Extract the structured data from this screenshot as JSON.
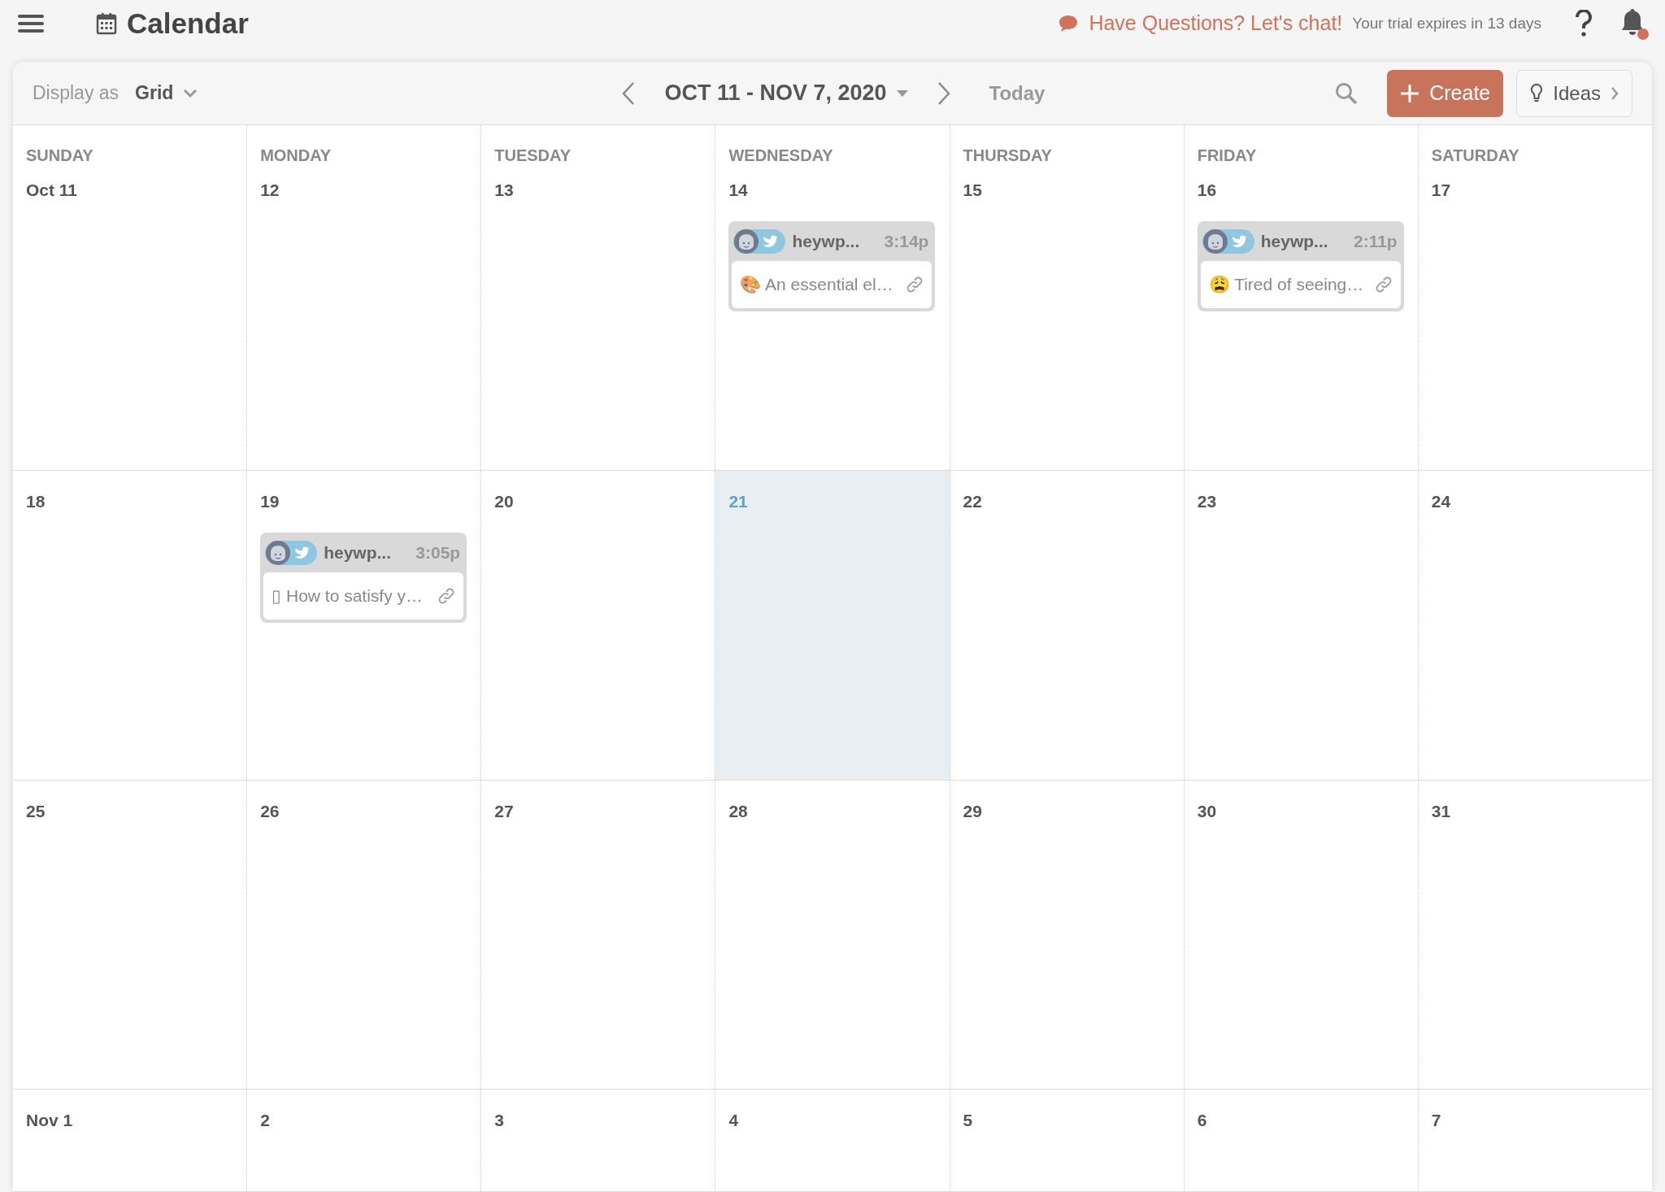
{
  "header": {
    "title": "Calendar",
    "chat_link": "Have Questions? Let's chat!",
    "trial_note": "Your trial expires in 13 days",
    "notification_dot": true
  },
  "toolbar": {
    "display_label": "Display as",
    "display_value": "Grid",
    "range": "OCT 11 - NOV 7, 2020",
    "today": "Today",
    "create": "Create",
    "ideas": "Ideas"
  },
  "weekdays": [
    "SUNDAY",
    "MONDAY",
    "TUESDAY",
    "WEDNESDAY",
    "THURSDAY",
    "FRIDAY",
    "SATURDAY"
  ],
  "weeks": [
    {
      "cells": [
        {
          "date": "Oct 11",
          "today": false
        },
        {
          "date": "12",
          "today": false
        },
        {
          "date": "13",
          "today": false
        },
        {
          "date": "14",
          "today": false,
          "events": [
            {
              "account": "heywp...",
              "time": "3:14p",
              "text": "🎨 An essential el…"
            }
          ]
        },
        {
          "date": "15",
          "today": false
        },
        {
          "date": "16",
          "today": false,
          "events": [
            {
              "account": "heywp...",
              "time": "2:11p",
              "text": "😩 Tired of seeing…"
            }
          ]
        },
        {
          "date": "17",
          "today": false
        }
      ]
    },
    {
      "cells": [
        {
          "date": "18",
          "today": false
        },
        {
          "date": "19",
          "today": false,
          "events": [
            {
              "account": "heywp...",
              "time": "3:05p",
              "text": "▯ How to satisfy y…"
            }
          ]
        },
        {
          "date": "20",
          "today": false
        },
        {
          "date": "21",
          "today": true
        },
        {
          "date": "22",
          "today": false
        },
        {
          "date": "23",
          "today": false
        },
        {
          "date": "24",
          "today": false
        }
      ]
    },
    {
      "cells": [
        {
          "date": "25",
          "today": false
        },
        {
          "date": "26",
          "today": false
        },
        {
          "date": "27",
          "today": false
        },
        {
          "date": "28",
          "today": false
        },
        {
          "date": "29",
          "today": false
        },
        {
          "date": "30",
          "today": false
        },
        {
          "date": "31",
          "today": false
        }
      ]
    },
    {
      "cells": [
        {
          "date": "Nov 1",
          "today": false
        },
        {
          "date": "2",
          "today": false
        },
        {
          "date": "3",
          "today": false
        },
        {
          "date": "4",
          "today": false
        },
        {
          "date": "5",
          "today": false
        },
        {
          "date": "6",
          "today": false
        },
        {
          "date": "7",
          "today": false
        }
      ]
    }
  ]
}
